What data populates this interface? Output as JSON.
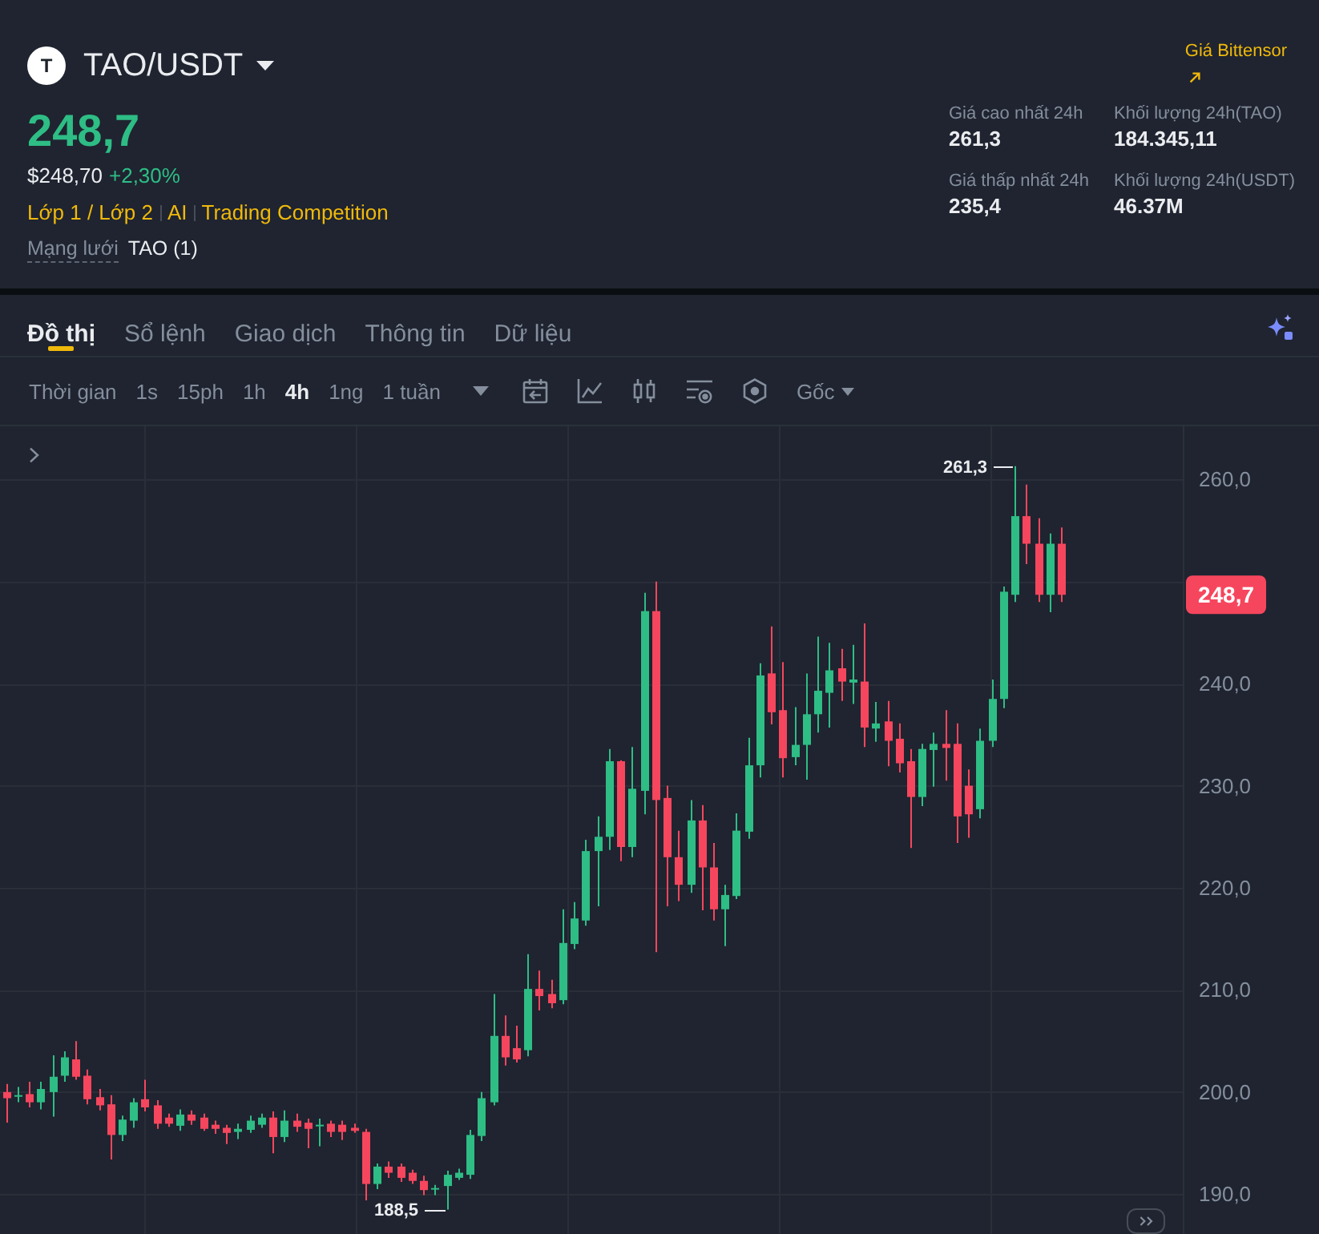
{
  "pair": {
    "logo_letter": "T",
    "symbol": "TAO/USDT",
    "price": "248,7",
    "usd_price": "$248,70",
    "change": "+2,30%"
  },
  "tags": [
    "Lớp 1 / Lớp 2",
    "AI",
    "Trading Competition"
  ],
  "network": {
    "label": "Mạng lưới",
    "value": "TAO (1)"
  },
  "price_link": "Giá Bittensor",
  "stats": [
    {
      "label": "Giá cao nhất 24h",
      "value": "261,3"
    },
    {
      "label": "Khối lượng 24h(TAO)",
      "value": "184.345,11"
    },
    {
      "label": "Giá thấp nhất 24h",
      "value": "235,4"
    },
    {
      "label": "Khối lượng 24h(USDT)",
      "value": "46.37M"
    }
  ],
  "tabs": [
    {
      "label": "Đồ thị",
      "selected": true
    },
    {
      "label": "Sổ lệnh",
      "selected": false
    },
    {
      "label": "Giao dịch",
      "selected": false
    },
    {
      "label": "Thông tin",
      "selected": false
    },
    {
      "label": "Dữ liệu",
      "selected": false
    }
  ],
  "toolbar": {
    "time_label": "Thời gian",
    "intervals": [
      {
        "label": "1s",
        "selected": false
      },
      {
        "label": "15ph",
        "selected": false
      },
      {
        "label": "1h",
        "selected": false
      },
      {
        "label": "4h",
        "selected": true
      },
      {
        "label": "1ng",
        "selected": false
      },
      {
        "label": "1 tuần",
        "selected": false
      }
    ],
    "price_type": "Gốc"
  },
  "chart": {
    "high_label": "261,3",
    "low_label": "188,5",
    "last_price": "248,7",
    "chart_data": {
      "type": "candlestick",
      "categories": [
        null,
        null,
        null,
        null,
        null,
        null,
        null,
        null,
        null,
        null,
        null,
        null,
        null,
        null,
        null,
        null,
        null,
        null,
        null,
        null,
        null,
        null,
        null,
        null,
        null,
        null,
        null,
        null,
        null,
        null,
        null,
        null,
        null,
        null,
        null,
        null,
        null,
        null,
        null,
        null,
        null,
        null,
        null,
        null,
        null,
        null,
        null,
        null,
        null,
        null,
        null,
        null,
        null,
        null,
        null,
        null,
        null,
        null,
        null,
        null,
        null,
        null,
        null,
        null,
        null,
        null,
        null,
        null,
        null,
        null,
        null,
        null,
        null,
        null,
        null,
        null,
        null,
        null,
        null,
        null,
        null,
        null,
        null,
        null,
        null,
        null,
        null,
        null,
        null,
        null,
        null,
        null,
        null,
        null,
        null,
        null,
        null,
        null,
        null,
        null,
        null,
        null
      ],
      "ohlc": [
        [
          200,
          200.8,
          197,
          199.4
        ],
        [
          199.6,
          200.5,
          199,
          199.7
        ],
        [
          199.8,
          201,
          198.5,
          199
        ],
        [
          199,
          201,
          198.3,
          200.3
        ],
        [
          200,
          203.6,
          197.6,
          201.5
        ],
        [
          201.6,
          204,
          201,
          203.4
        ],
        [
          203.2,
          205,
          201.2,
          201.5
        ],
        [
          201.6,
          202.2,
          198.8,
          199.3
        ],
        [
          199.5,
          200.3,
          198.2,
          198.7
        ],
        [
          198.8,
          199.7,
          193.4,
          195.8
        ],
        [
          195.8,
          197.7,
          195.2,
          197.3
        ],
        [
          197.2,
          199.4,
          196.5,
          199
        ],
        [
          199.3,
          201.2,
          198.1,
          198.5
        ],
        [
          198.7,
          199.2,
          196.4,
          196.9
        ],
        [
          197.5,
          197.9,
          196.6,
          196.9
        ],
        [
          196.7,
          198.3,
          196.2,
          197.8
        ],
        [
          197.8,
          198.2,
          196.8,
          197.2
        ],
        [
          197.5,
          197.9,
          196.2,
          196.4
        ],
        [
          196.8,
          197.2,
          195.9,
          196.4
        ],
        [
          196.5,
          196.8,
          194.9,
          196
        ],
        [
          196.1,
          196.9,
          195.4,
          196.4
        ],
        [
          196.3,
          197.7,
          196,
          197.2
        ],
        [
          196.8,
          197.9,
          196.5,
          197.5
        ],
        [
          197.5,
          198.1,
          194,
          195.6
        ],
        [
          195.6,
          198.2,
          195.1,
          197.2
        ],
        [
          197.2,
          197.9,
          196.1,
          196.6
        ],
        [
          197,
          197.4,
          194.5,
          196.4
        ],
        [
          196.7,
          197.4,
          194.7,
          196.8
        ],
        [
          196.9,
          197.2,
          195.6,
          196.1
        ],
        [
          196.8,
          197.2,
          195.3,
          196.1
        ],
        [
          196.5,
          196.9,
          196,
          196.2
        ],
        [
          196.1,
          196.4,
          189.4,
          191
        ],
        [
          191,
          193,
          190.5,
          192.7
        ],
        [
          192.7,
          193.2,
          191.6,
          192.1
        ],
        [
          192.7,
          193,
          191.2,
          191.6
        ],
        [
          192.1,
          192.4,
          191,
          191.3
        ],
        [
          191.3,
          191.8,
          189.9,
          190.4
        ],
        [
          190.5,
          190.9,
          189.9,
          190.6
        ],
        [
          190.8,
          192.3,
          188.5,
          191.9
        ],
        [
          191.6,
          192.5,
          191.4,
          192.1
        ],
        [
          191.9,
          196.3,
          191.5,
          195.8
        ],
        [
          195.7,
          200,
          195.2,
          199.4
        ],
        [
          199,
          209.6,
          198.7,
          205.5
        ],
        [
          205.5,
          207.5,
          202.6,
          203.4
        ],
        [
          204.3,
          206.5,
          202.9,
          203.2
        ],
        [
          204.1,
          213.5,
          203.5,
          210.1
        ],
        [
          210.1,
          211.9,
          208,
          209.4
        ],
        [
          209.6,
          211,
          208.2,
          208.7
        ],
        [
          209,
          217.9,
          208.6,
          214.6
        ],
        [
          214.5,
          218.6,
          214,
          217
        ],
        [
          216.8,
          224.7,
          216.3,
          223.6
        ],
        [
          223.6,
          227,
          218.2,
          225
        ],
        [
          225,
          233.6,
          223.7,
          232.4
        ],
        [
          232.4,
          232.5,
          222.6,
          224
        ],
        [
          224,
          233.8,
          223,
          229.7
        ],
        [
          229.5,
          248.9,
          227.2,
          247.1
        ],
        [
          247.1,
          250,
          213.7,
          228.6
        ],
        [
          228.8,
          230,
          218.2,
          223
        ],
        [
          223,
          225.6,
          218.7,
          220.3
        ],
        [
          220.3,
          228.6,
          219.5,
          226.6
        ],
        [
          226.6,
          228.1,
          217.8,
          222
        ],
        [
          222,
          224.4,
          216.8,
          217.9
        ],
        [
          217.9,
          220.3,
          214.3,
          219.3
        ],
        [
          219.2,
          227.3,
          218.9,
          225.6
        ],
        [
          225.5,
          234.7,
          224.8,
          232
        ],
        [
          232,
          242,
          230.8,
          240.8
        ],
        [
          241,
          245.6,
          236,
          237.2
        ],
        [
          237.4,
          242.1,
          230.8,
          232.7
        ],
        [
          232.8,
          237.7,
          232,
          234
        ],
        [
          234,
          241,
          230.6,
          237
        ],
        [
          237,
          244.6,
          235.2,
          239.3
        ],
        [
          239.1,
          244,
          235.7,
          241.3
        ],
        [
          241.5,
          243.4,
          238.3,
          240.2
        ],
        [
          240.1,
          243.8,
          238,
          240.4
        ],
        [
          240.2,
          245.9,
          233.8,
          235.7
        ],
        [
          235.6,
          238.2,
          234.3,
          236.1
        ],
        [
          236.3,
          238.3,
          231.9,
          234.4
        ],
        [
          234.6,
          236.1,
          231.3,
          232.2
        ],
        [
          232.4,
          233.6,
          223.9,
          228.9
        ],
        [
          228.9,
          234.1,
          228,
          233.6
        ],
        [
          233.5,
          235.2,
          229.9,
          234.1
        ],
        [
          234.1,
          237.4,
          230.5,
          233.7
        ],
        [
          234.1,
          236.1,
          224.4,
          227
        ],
        [
          230,
          231.6,
          224.9,
          227.2
        ],
        [
          227.7,
          235.6,
          226.8,
          234.4
        ],
        [
          234.4,
          240.4,
          233.8,
          238.5
        ],
        [
          238.5,
          249.5,
          237.6,
          249
        ],
        [
          248.7,
          261.3,
          248,
          256.4
        ],
        [
          256.4,
          259.5,
          251.7,
          253.7
        ],
        [
          253.7,
          256.2,
          248,
          248.7
        ],
        [
          248.7,
          254.7,
          247,
          253.7
        ],
        [
          253.7,
          255.3,
          248,
          248.7
        ],
        null,
        null,
        null,
        null,
        null,
        null,
        null,
        null,
        null,
        null
      ],
      "ylim": [
        186.1,
        265.2
      ],
      "grid": true,
      "yticks": [
        {
          "value": 260,
          "label": "260,0"
        },
        {
          "value": 240,
          "label": "240,0"
        },
        {
          "value": 230,
          "label": "230,0"
        },
        {
          "value": 220,
          "label": "220,0"
        },
        {
          "value": 210,
          "label": "210,0"
        },
        {
          "value": 200,
          "label": "200,0"
        },
        {
          "value": 190,
          "label": "190,0"
        }
      ]
    }
  }
}
